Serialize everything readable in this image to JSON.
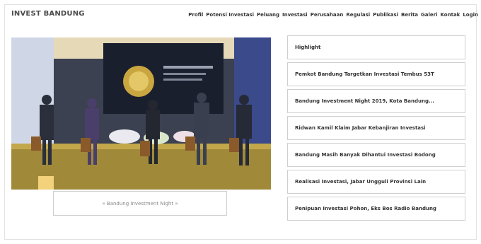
{
  "brand": "INVEST BANDUNG",
  "nav": [
    "Profil",
    "Potensi Investasi",
    "Peluang",
    "Investasi",
    "Perusahaan",
    "Regulasi",
    "Publikasi",
    "Berita",
    "Galeri",
    "Kontak",
    "Login"
  ],
  "hero": {
    "caption": "« Bandung Investment Night »"
  },
  "sidebar": {
    "heading": "Highlight",
    "items": [
      "Pemkot Bandung Targetkan Investasi Tembus 53T",
      "Bandung Investment Night 2019, Kota Bandung...",
      "Ridwan Kamil Klaim Jabar Kebanjiran Investasi",
      "Bandung Masih Banyak Dihantui Investasi Bodong",
      "Realisasi Investasi, Jabar Ungguli Provinsi Lain",
      "Penipuan Investasi Pohon, Eks Bos Radio Bandung"
    ]
  }
}
